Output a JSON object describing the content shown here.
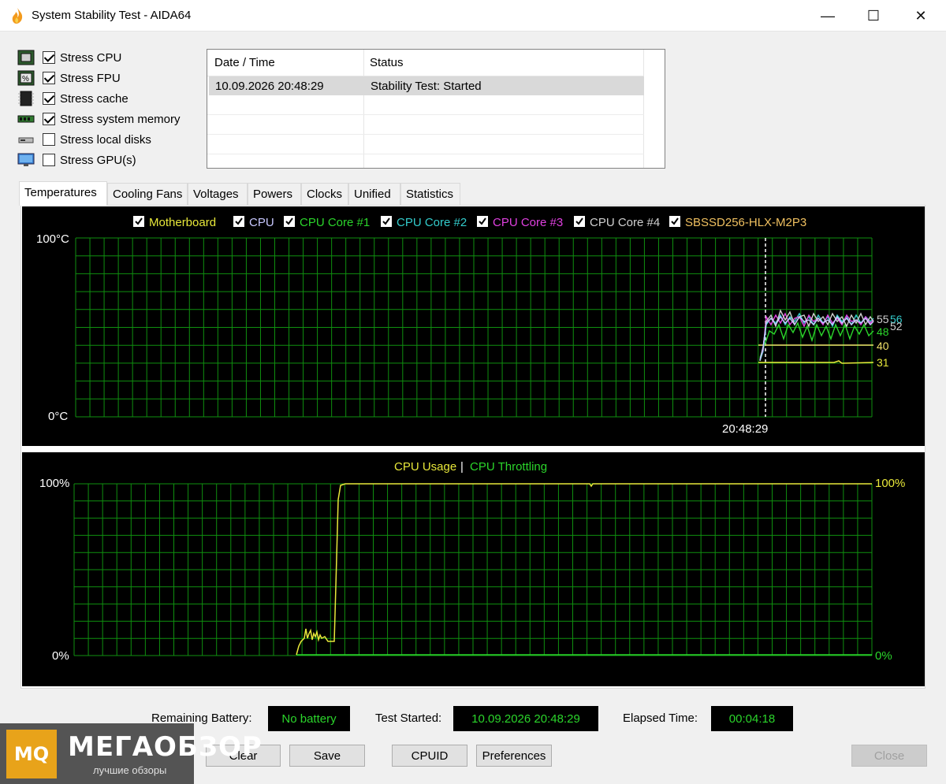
{
  "window": {
    "title": "System Stability Test - AIDA64",
    "minimize": "—",
    "maximize": "☐",
    "close": "✕"
  },
  "stress": [
    {
      "label": "Stress CPU",
      "checked": true,
      "icon": "cpu-chip-icon"
    },
    {
      "label": "Stress FPU",
      "checked": true,
      "icon": "fpu-icon"
    },
    {
      "label": "Stress cache",
      "checked": true,
      "icon": "cache-chip-icon"
    },
    {
      "label": "Stress system memory",
      "checked": true,
      "icon": "memory-module-icon"
    },
    {
      "label": "Stress local disks",
      "checked": false,
      "icon": "disk-drive-icon"
    },
    {
      "label": "Stress GPU(s)",
      "checked": false,
      "icon": "monitor-gpu-icon"
    }
  ],
  "log": {
    "headers": [
      "Date / Time",
      "Status"
    ],
    "rows": [
      {
        "datetime": "10.09.2026 20:48:29",
        "status": "Stability Test: Started"
      }
    ]
  },
  "tabs": [
    "Temperatures",
    "Cooling Fans",
    "Voltages",
    "Powers",
    "Clocks",
    "Unified",
    "Statistics"
  ],
  "active_tab": "Temperatures",
  "temp_legend": [
    {
      "label": "Motherboard",
      "color": "#e8e83a"
    },
    {
      "label": "CPU",
      "color": "#c8c8ff"
    },
    {
      "label": "CPU Core #1",
      "color": "#2bd52b"
    },
    {
      "label": "CPU Core #2",
      "color": "#33cccc"
    },
    {
      "label": "CPU Core #3",
      "color": "#e040e0"
    },
    {
      "label": "CPU Core #4",
      "color": "#d0d0d0"
    },
    {
      "label": "SBSSD256-HLX-M2P3",
      "color": "#f0c060"
    }
  ],
  "temp_axis": {
    "max_label": "100°C",
    "min_label": "0°C",
    "time_label": "20:48:29"
  },
  "temp_values": {
    "v55": "55",
    "v56": "56",
    "v52": "52",
    "v48": "48",
    "v40": "40",
    "v31": "31"
  },
  "cpu_legend": {
    "usage": "CPU Usage",
    "sep": "|",
    "throttling": "CPU Throttling"
  },
  "cpu_axis": {
    "left_max": "100%",
    "left_min": "0%",
    "right_max": "100%",
    "right_min": "0%"
  },
  "chart_data": [
    {
      "type": "line",
      "title": "",
      "ylim": [
        0,
        100
      ],
      "ylabel": "°C",
      "series": [
        {
          "name": "Motherboard",
          "values": [
            31,
            31,
            31
          ]
        },
        {
          "name": "CPU",
          "values": [
            30,
            52,
            55
          ]
        },
        {
          "name": "CPU Core #1",
          "values": [
            30,
            48,
            48
          ]
        },
        {
          "name": "CPU Core #2",
          "values": [
            30,
            56,
            56
          ]
        },
        {
          "name": "CPU Core #3",
          "values": [
            30,
            55,
            55
          ]
        },
        {
          "name": "CPU Core #4",
          "values": [
            30,
            52,
            52
          ]
        },
        {
          "name": "SBSSD256-HLX-M2P3",
          "values": [
            40,
            40,
            40
          ]
        }
      ],
      "x": [
        "",
        "20:48:29",
        ""
      ]
    },
    {
      "type": "line",
      "title": "",
      "ylim": [
        0,
        100
      ],
      "series": [
        {
          "name": "CPU Usage",
          "values": [
            0,
            12,
            10,
            100,
            100
          ]
        },
        {
          "name": "CPU Throttling",
          "values": [
            0,
            0,
            0,
            0,
            0
          ]
        }
      ]
    }
  ],
  "status": {
    "battery_label": "Remaining Battery:",
    "battery_value": "No battery",
    "started_label": "Test Started:",
    "started_value": "10.09.2026 20:48:29",
    "elapsed_label": "Elapsed Time:",
    "elapsed_value": "00:04:18"
  },
  "buttons": {
    "clear": "Clear",
    "save": "Save",
    "cpuid": "CPUID",
    "preferences": "Preferences",
    "close": "Close"
  },
  "watermark": {
    "logo": "MQ",
    "title": "МЕГАОБЗОР",
    "subtitle": "лучшие обзоры"
  },
  "colors": {
    "graph_bg": "#000000",
    "grid": "#0f8f0f",
    "accent_green": "#2bd52b",
    "yellow": "#e8e83a"
  }
}
